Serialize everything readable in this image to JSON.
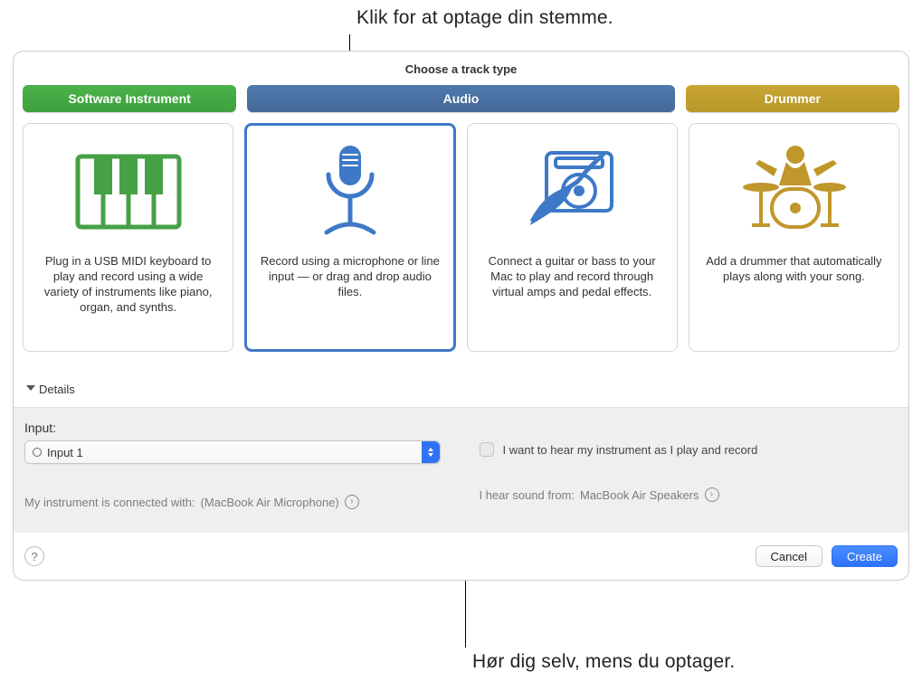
{
  "callouts": {
    "top": "Klik for at optage din stemme.",
    "bottom": "Hør dig selv, mens du optager."
  },
  "panel": {
    "title": "Choose a track type",
    "headers": {
      "software": "Software Instrument",
      "audio": "Audio",
      "drummer": "Drummer"
    },
    "cards": {
      "softwareInstrument": "Plug in a USB MIDI keyboard to play and record using a wide variety of instruments like piano, organ, and synths.",
      "micAudio": "Record using a microphone or line input — or drag and drop audio files.",
      "guitarAudio": "Connect a guitar or bass to your Mac to play and record through virtual amps and pedal effects.",
      "drummer": "Add a drummer that automatically plays along with your song."
    },
    "detailsLabel": "Details"
  },
  "details": {
    "inputLabel": "Input:",
    "inputValue": "Input 1",
    "instrumentLinePrefix": "My instrument is connected with: ",
    "instrumentLineDevice": "(MacBook Air Microphone)",
    "monitorCheckboxLabel": "I want to hear my instrument as I play and record",
    "outputLinePrefix": "I hear sound from: ",
    "outputLineDevice": "MacBook Air Speakers"
  },
  "footer": {
    "helpGlyph": "?",
    "cancel": "Cancel",
    "create": "Create"
  },
  "glyphs": {
    "circArrow": "›"
  }
}
